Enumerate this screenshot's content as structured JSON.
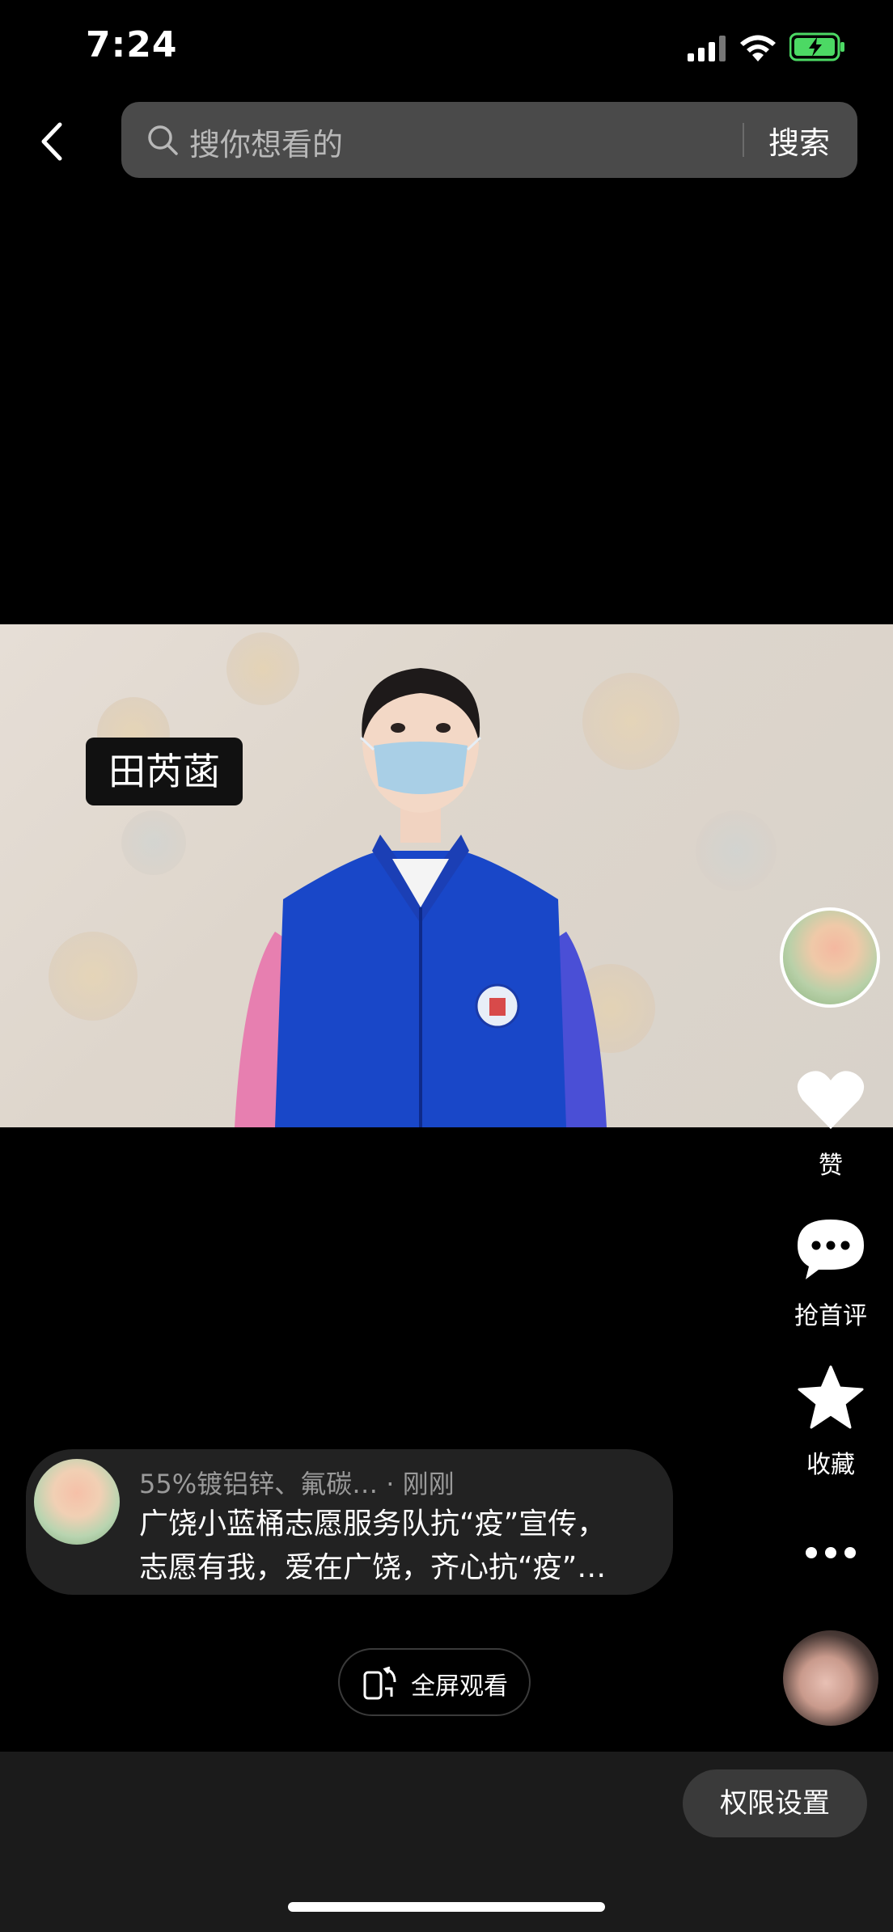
{
  "status_bar": {
    "time": "7:24"
  },
  "search": {
    "placeholder": "搜你想看的",
    "button_label": "搜索"
  },
  "video": {
    "name_caption": "田芮菡"
  },
  "actions": {
    "like_label": "赞",
    "comment_label": "抢首评",
    "favorite_label": "收藏"
  },
  "info": {
    "meta": "55%镀铝锌、氟碳…  · 刚刚",
    "desc_line1": "广饶小蓝桶志愿服务队抗“疫”宣传，",
    "desc_line2": "志愿有我，爱在广饶，齐心抗“疫”…"
  },
  "fullscreen": {
    "label": "全屏观看"
  },
  "bottom": {
    "permission_label": "权限设置"
  },
  "colors": {
    "background": "#000000",
    "search_bg": "#4a4a4a",
    "battery_green": "#4cd964",
    "card_bg": "#282828"
  },
  "icons": {
    "back": "chevron-left-icon",
    "search": "search-icon",
    "like": "heart-icon",
    "comment": "chat-bubble-icon",
    "favorite": "star-icon",
    "more": "more-dots-icon",
    "fullscreen": "rotate-phone-icon"
  }
}
